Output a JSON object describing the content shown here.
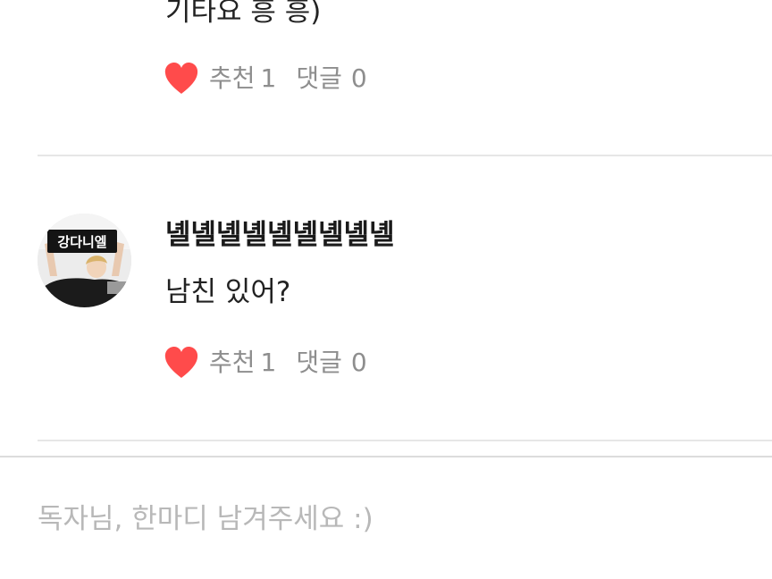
{
  "comments": [
    {
      "author": "",
      "text": "기타요 흥 흥)",
      "like_label": "추천",
      "like_count": "1",
      "reply_label": "댓글",
      "reply_count": "0"
    },
    {
      "author": "녤녤녤녤녤녤녤녤녤",
      "avatar_sign_text": "강다니엘",
      "text": "남친 있어?",
      "like_label": "추천",
      "like_count": "1",
      "reply_label": "댓글",
      "reply_count": "0"
    }
  ],
  "reply_box": {
    "placeholder": "독자님, 한마디 남겨주세요 :)"
  },
  "colors": {
    "heart": "#ff4b4b",
    "action_text": "#8e8e8e",
    "divider": "#e6e6e6",
    "placeholder": "#b8b8b8"
  }
}
